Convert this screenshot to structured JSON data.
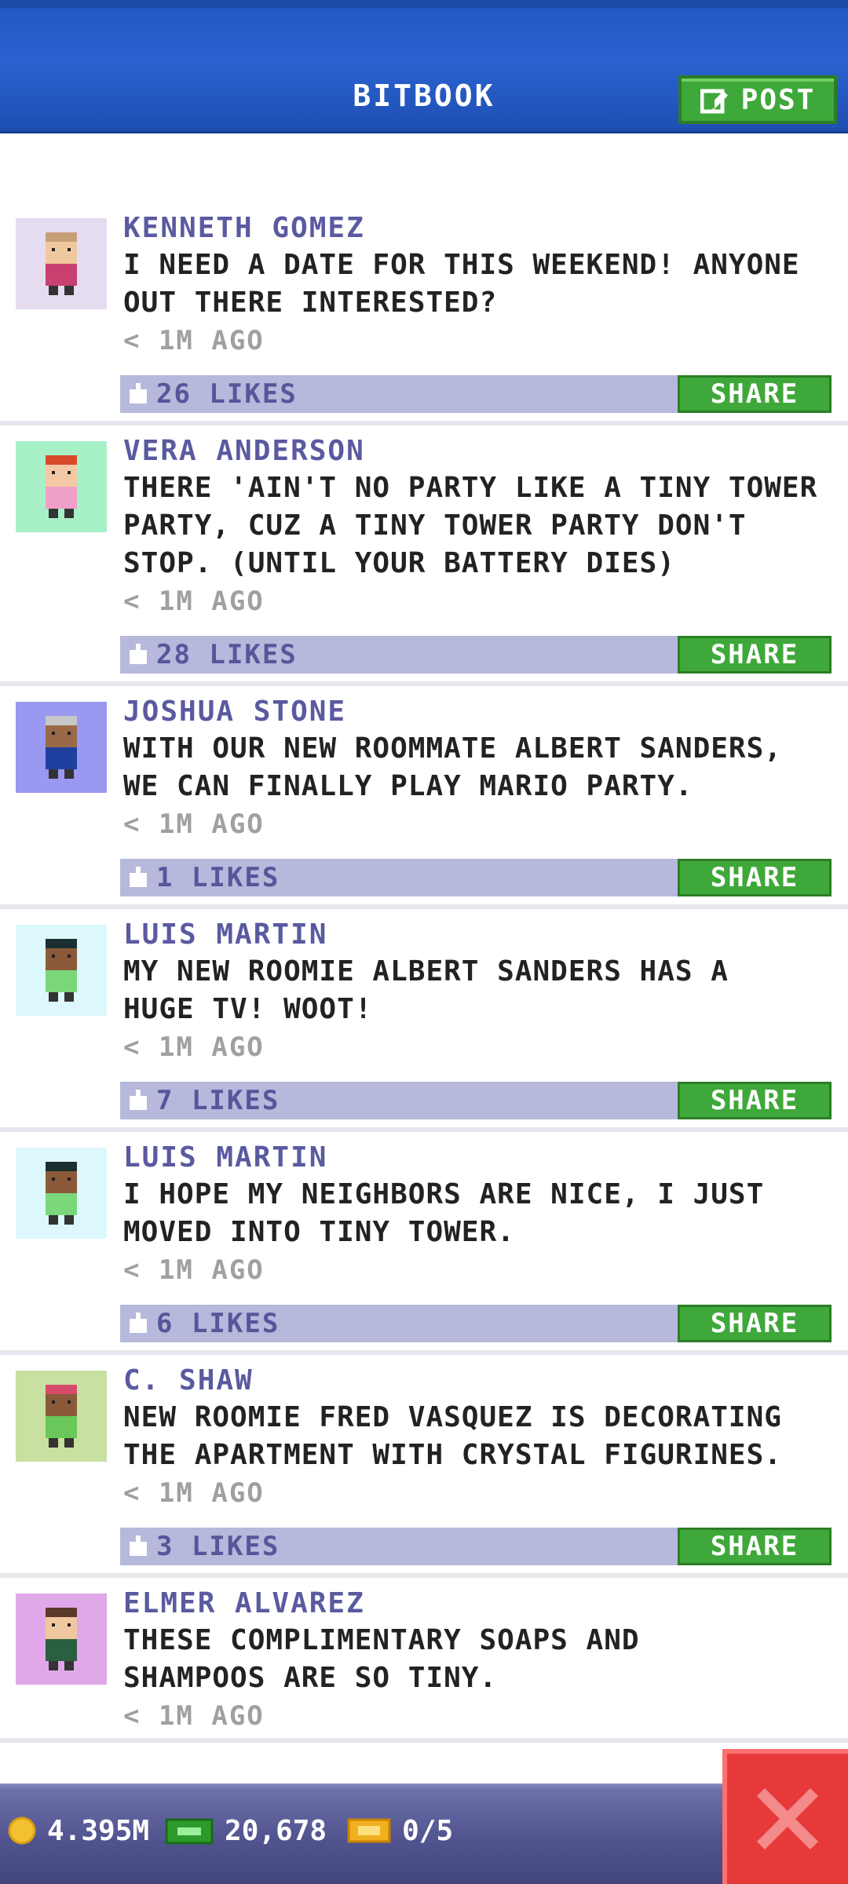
{
  "header": {
    "title": "BITBOOK",
    "post_label": "POST"
  },
  "posts": [
    {
      "name": "KENNETH GOMEZ",
      "message": "I NEED A DATE FOR THIS WEEKEND! ANYONE\nOUT THERE INTERESTED?",
      "time": "< 1M AGO",
      "likes": "26 LIKES",
      "share_label": "SHARE",
      "avatar_bg": "#e6dcf0",
      "skin": "#f0c8a0",
      "hair": "#c8a078",
      "shirt": "#c84070"
    },
    {
      "name": "VERA ANDERSON",
      "message": "THERE 'AIN'T NO PARTY LIKE A TINY TOWER\nPARTY, CUZ A TINY TOWER PARTY DON'T\nSTOP. (UNTIL YOUR BATTERY DIES)",
      "time": "< 1M AGO",
      "likes": "28 LIKES",
      "share_label": "SHARE",
      "avatar_bg": "#a8f0c8",
      "skin": "#f4c8a4",
      "hair": "#d84a2a",
      "shirt": "#f0a0c8"
    },
    {
      "name": "JOSHUA STONE",
      "message": "WITH OUR NEW ROOMMATE ALBERT SANDERS,\nWE CAN FINALLY PLAY MARIO PARTY.",
      "time": "< 1M AGO",
      "likes": "1 LIKES",
      "share_label": "SHARE",
      "avatar_bg": "#9a98f0",
      "skin": "#9a6a48",
      "hair": "#c8c8c8",
      "shirt": "#2040a0"
    },
    {
      "name": "LUIS MARTIN",
      "message": "MY NEW ROOMIE ALBERT SANDERS HAS A\nHUGE TV! WOOT!",
      "time": "< 1M AGO",
      "likes": "7 LIKES",
      "share_label": "SHARE",
      "avatar_bg": "#dcf8fc",
      "skin": "#8a5a3a",
      "hair": "#1a3030",
      "shirt": "#7ad87a"
    },
    {
      "name": "LUIS MARTIN",
      "message": "I HOPE MY NEIGHBORS ARE NICE, I JUST\nMOVED INTO TINY TOWER.",
      "time": "< 1M AGO",
      "likes": "6 LIKES",
      "share_label": "SHARE",
      "avatar_bg": "#dcf8fc",
      "skin": "#8a5a3a",
      "hair": "#1a3030",
      "shirt": "#7ad87a"
    },
    {
      "name": "C. SHAW",
      "message": "NEW ROOMIE FRED VASQUEZ IS DECORATING\nTHE APARTMENT WITH CRYSTAL FIGURINES.",
      "time": "< 1M AGO",
      "likes": "3 LIKES",
      "share_label": "SHARE",
      "avatar_bg": "#c8e0a0",
      "skin": "#8a5a3a",
      "hair": "#d84a6a",
      "shirt": "#6ac85a"
    },
    {
      "name": "ELMER ALVAREZ",
      "message": "THESE COMPLIMENTARY SOAPS AND\nSHAMPOOS ARE SO TINY.",
      "time": "< 1M AGO",
      "likes": "",
      "share_label": "",
      "avatar_bg": "#e0a8e8",
      "skin": "#f0c8a0",
      "hair": "#5a3a28",
      "shirt": "#2a6040"
    }
  ],
  "footer": {
    "coins": "4.395M",
    "bux": "20,678",
    "tickets": "0/5"
  },
  "colors": {
    "header_blue": "#2a62d0",
    "share_green": "#3fa83a",
    "like_bar": "#b6b8dc",
    "name_purple": "#5a5aa0",
    "close_red": "#e63a3a"
  }
}
